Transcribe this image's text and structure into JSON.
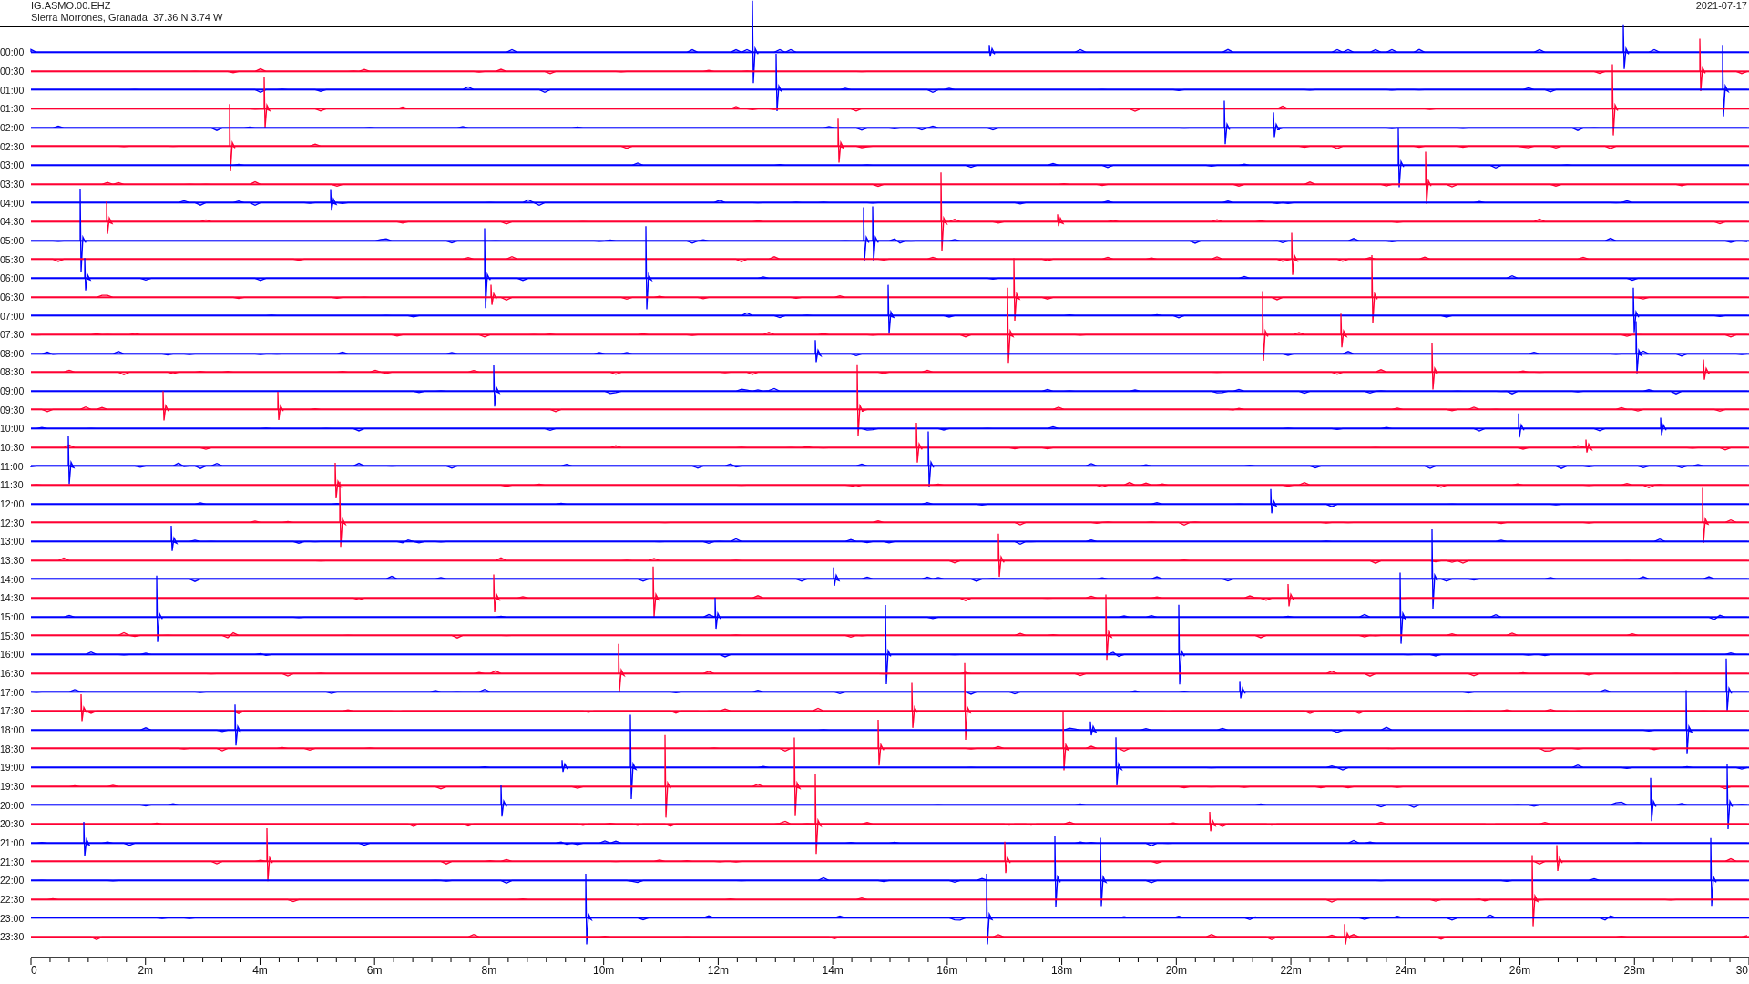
{
  "header": {
    "station": "IG.ASMO.00.EHZ",
    "location": "Sierra Morrones, Granada  37.36 N 3.74 W",
    "date": "2021-07-17"
  },
  "traces": [
    {
      "label": "00:00",
      "color": "#0000ff"
    },
    {
      "label": "00:30",
      "color": "#ff0033"
    },
    {
      "label": "01:00",
      "color": "#0000ff"
    },
    {
      "label": "01:30",
      "color": "#ff0033"
    },
    {
      "label": "02:00",
      "color": "#0000ff"
    },
    {
      "label": "02:30",
      "color": "#ff0033"
    },
    {
      "label": "03:00",
      "color": "#0000ff"
    },
    {
      "label": "03:30",
      "color": "#ff0033"
    },
    {
      "label": "04:00",
      "color": "#0000ff"
    },
    {
      "label": "04:30",
      "color": "#ff0033"
    },
    {
      "label": "05:00",
      "color": "#0000ff"
    },
    {
      "label": "05:30",
      "color": "#ff0033"
    },
    {
      "label": "06:00",
      "color": "#0000ff"
    },
    {
      "label": "06:30",
      "color": "#ff0033"
    },
    {
      "label": "07:00",
      "color": "#0000ff"
    },
    {
      "label": "07:30",
      "color": "#ff0033"
    },
    {
      "label": "08:00",
      "color": "#0000ff"
    },
    {
      "label": "08:30",
      "color": "#ff0033"
    },
    {
      "label": "09:00",
      "color": "#0000ff"
    },
    {
      "label": "09:30",
      "color": "#ff0033"
    },
    {
      "label": "10:00",
      "color": "#0000ff"
    },
    {
      "label": "10:30",
      "color": "#ff0033"
    },
    {
      "label": "11:00",
      "color": "#0000ff"
    },
    {
      "label": "11:30",
      "color": "#ff0033"
    },
    {
      "label": "12:00",
      "color": "#0000ff"
    },
    {
      "label": "12:30",
      "color": "#ff0033"
    },
    {
      "label": "13:00",
      "color": "#0000ff"
    },
    {
      "label": "13:30",
      "color": "#ff0033"
    },
    {
      "label": "14:00",
      "color": "#0000ff"
    },
    {
      "label": "14:30",
      "color": "#ff0033"
    },
    {
      "label": "15:00",
      "color": "#0000ff"
    },
    {
      "label": "15:30",
      "color": "#ff0033"
    },
    {
      "label": "16:00",
      "color": "#0000ff"
    },
    {
      "label": "16:30",
      "color": "#ff0033"
    },
    {
      "label": "17:00",
      "color": "#0000ff"
    },
    {
      "label": "17:30",
      "color": "#ff0033"
    },
    {
      "label": "18:00",
      "color": "#0000ff"
    },
    {
      "label": "18:30",
      "color": "#ff0033"
    },
    {
      "label": "19:00",
      "color": "#0000ff"
    },
    {
      "label": "19:30",
      "color": "#ff0033"
    },
    {
      "label": "20:00",
      "color": "#0000ff"
    },
    {
      "label": "20:30",
      "color": "#ff0033"
    },
    {
      "label": "21:00",
      "color": "#0000ff"
    },
    {
      "label": "21:30",
      "color": "#ff0033"
    },
    {
      "label": "22:00",
      "color": "#0000ff"
    },
    {
      "label": "22:30",
      "color": "#ff0033"
    },
    {
      "label": "23:00",
      "color": "#0000ff"
    },
    {
      "label": "23:30",
      "color": "#ff0033"
    }
  ],
  "x_axis": {
    "tick_labels": [
      "0",
      "2m",
      "4m",
      "6m",
      "8m",
      "10m",
      "12m",
      "14m",
      "16m",
      "18m",
      "20m",
      "22m",
      "24m",
      "26m",
      "28m",
      "30"
    ]
  }
}
